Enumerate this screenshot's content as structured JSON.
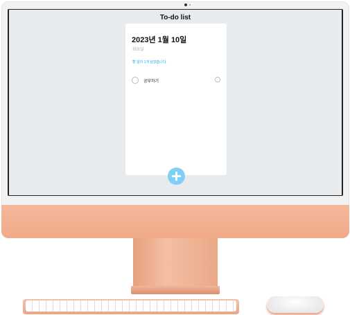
{
  "app": {
    "title": "To-do list"
  },
  "card": {
    "date": "2023년 1월 10일",
    "weekday": "화요일",
    "remaining": "할 일이 1개 남았습니다."
  },
  "todos": [
    {
      "label": "공부하기",
      "done": false
    }
  ],
  "icons": {
    "add": "plus-icon",
    "check": "circle-checkbox-icon",
    "delete": "remove-icon"
  },
  "colors": {
    "accent": "#7fd0f4",
    "remaining_text": "#1aa3e8",
    "screen_bg": "#e8ebee",
    "imac_chin": "#f5b79a"
  }
}
